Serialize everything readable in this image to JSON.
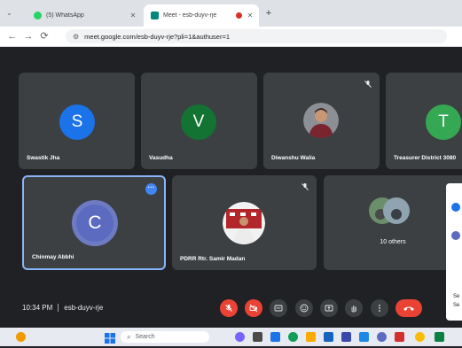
{
  "browser": {
    "tabs": [
      {
        "title": "(5) WhatsApp",
        "active": false
      },
      {
        "title": "Meet - esb-duyv-rje",
        "active": true
      }
    ],
    "url": "meet.google.com/esb-duyv-rje?pli=1&authuser=1"
  },
  "participants": [
    {
      "name": "Swastik Jha",
      "initial": "S",
      "color": "#1a73e8"
    },
    {
      "name": "Vasudha",
      "initial": "V",
      "color": "#137333"
    },
    {
      "name": "Diwanshu Walia",
      "initial": "",
      "photo": true
    },
    {
      "name": "Treasurer District 3080",
      "initial": "T",
      "color": "#34a853"
    },
    {
      "name": "Chinmay Abbhi",
      "initial": "C",
      "color": "#5c6bc0"
    },
    {
      "name": "PDRR Rtr. Samir Madan",
      "initial": "",
      "photo": true
    },
    {
      "name": "10 others",
      "initial": ""
    }
  ],
  "meeting": {
    "time": "10:34 PM",
    "code": "esb-duyv-rje"
  },
  "side_panel": {
    "text1": "Se",
    "text2": "Se"
  },
  "taskbar": {
    "search_placeholder": "Search"
  },
  "colors": {
    "background": "#202124",
    "tile": "#3c4043",
    "red": "#ea4335",
    "accent": "#4285f4"
  }
}
